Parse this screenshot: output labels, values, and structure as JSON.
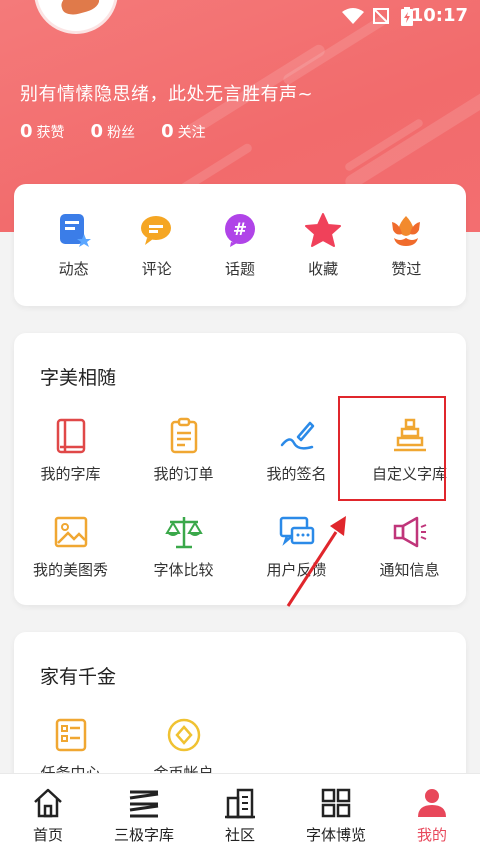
{
  "status_bar": {
    "time": "10:17"
  },
  "profile": {
    "signature": "别有情愫隐思绪，此处无言胜有声~",
    "stats": [
      {
        "value": "0",
        "label": "获赞"
      },
      {
        "value": "0",
        "label": "粉丝"
      },
      {
        "value": "0",
        "label": "关注"
      }
    ]
  },
  "activity": [
    {
      "label": "动态",
      "icon": "dynamic-icon"
    },
    {
      "label": "评论",
      "icon": "comment-icon"
    },
    {
      "label": "话题",
      "icon": "topic-icon"
    },
    {
      "label": "收藏",
      "icon": "star-icon"
    },
    {
      "label": "赞过",
      "icon": "flower-icon"
    }
  ],
  "section1": {
    "title": "字美相随",
    "items": [
      {
        "label": "我的字库",
        "icon": "book-icon"
      },
      {
        "label": "我的订单",
        "icon": "clipboard-icon"
      },
      {
        "label": "我的签名",
        "icon": "pen-icon"
      },
      {
        "label": "自定义字库",
        "icon": "pagoda-icon"
      },
      {
        "label": "我的美图秀",
        "icon": "image-icon"
      },
      {
        "label": "字体比较",
        "icon": "balance-icon"
      },
      {
        "label": "用户反馈",
        "icon": "feedback-icon"
      },
      {
        "label": "通知信息",
        "icon": "megaphone-icon"
      }
    ]
  },
  "section2": {
    "title": "家有千金",
    "items": [
      {
        "label": "任务中心",
        "icon": "task-icon"
      },
      {
        "label": "金币帐户",
        "icon": "coin-icon"
      }
    ]
  },
  "tabs": [
    {
      "label": "首页",
      "icon": "home-icon"
    },
    {
      "label": "三极字库",
      "icon": "font-library-icon"
    },
    {
      "label": "社区",
      "icon": "community-icon"
    },
    {
      "label": "字体博览",
      "icon": "grid-icon"
    },
    {
      "label": "我的",
      "icon": "user-icon"
    }
  ],
  "colors": {
    "header": "#f26b6c",
    "active_tab": "#e8475a",
    "highlight_box": "#e0262c"
  }
}
